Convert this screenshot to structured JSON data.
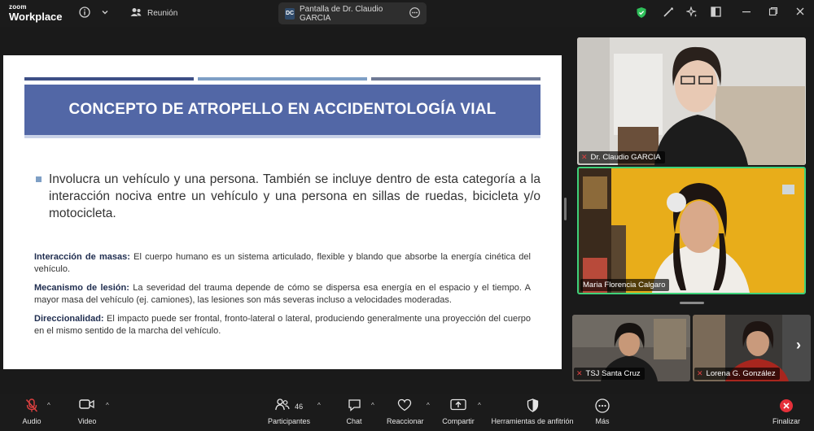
{
  "app": {
    "logo_line1": "zoom",
    "logo_line2": "Workplace"
  },
  "topbar": {
    "info_icon": "info-icon",
    "chevron": "chevron-down-icon",
    "meeting_tab": "Reunión",
    "share_badge": "DC",
    "share_tab": "Pantalla de Dr. Claudio GARCIA",
    "more_icon": "ellipsis-icon"
  },
  "slide": {
    "title": "CONCEPTO DE ATROPELLO EN ACCIDENTOLOGÍA VIAL",
    "bullet": "Involucra un vehículo y una persona. También se incluye dentro de esta categoría a la interacción nociva entre un vehículo y una persona en sillas de ruedas, bicicleta y/o motocicleta.",
    "items": [
      {
        "label": "Interacción de masas:",
        "text": " El cuerpo humano es un sistema articulado, flexible y blando que absorbe la energía cinética del vehículo."
      },
      {
        "label": "Mecanismo de lesión:",
        "text": " La severidad del trauma depende de cómo se dispersa esa energía en el espacio y el tiempo. A mayor masa del vehículo (ej. camiones), las lesiones son más severas incluso a velocidades moderadas."
      },
      {
        "label": "Direccionalidad:",
        "text": " El impacto puede ser frontal, fronto-lateral o lateral, produciendo generalmente una proyección del cuerpo en el mismo sentido de la marcha del vehículo."
      }
    ],
    "colors": {
      "title_bg": "#5267a6",
      "bar1": "#3d4f86",
      "bar2": "#7e9fc5",
      "bar3": "#6f7a95"
    }
  },
  "participants": [
    {
      "name": "Dr. Claudio GARCIA",
      "muted": true
    },
    {
      "name": "Maria Florencia Calgaro",
      "muted": false,
      "active_speaker": true
    },
    {
      "name": "TSJ Santa Cruz",
      "muted": true
    },
    {
      "name": "Lorena G. González",
      "muted": true
    }
  ],
  "toolbar": {
    "audio": "Audio",
    "video": "Video",
    "participants": "Participantes",
    "participants_count": "46",
    "chat": "Chat",
    "reactions": "Reaccionar",
    "share": "Compartir",
    "host_tools": "Herramientas de anfitrión",
    "more": "Más",
    "end": "Finalizar"
  },
  "accent": {
    "active_border": "#3ed27a",
    "end_red": "#e5303a"
  }
}
